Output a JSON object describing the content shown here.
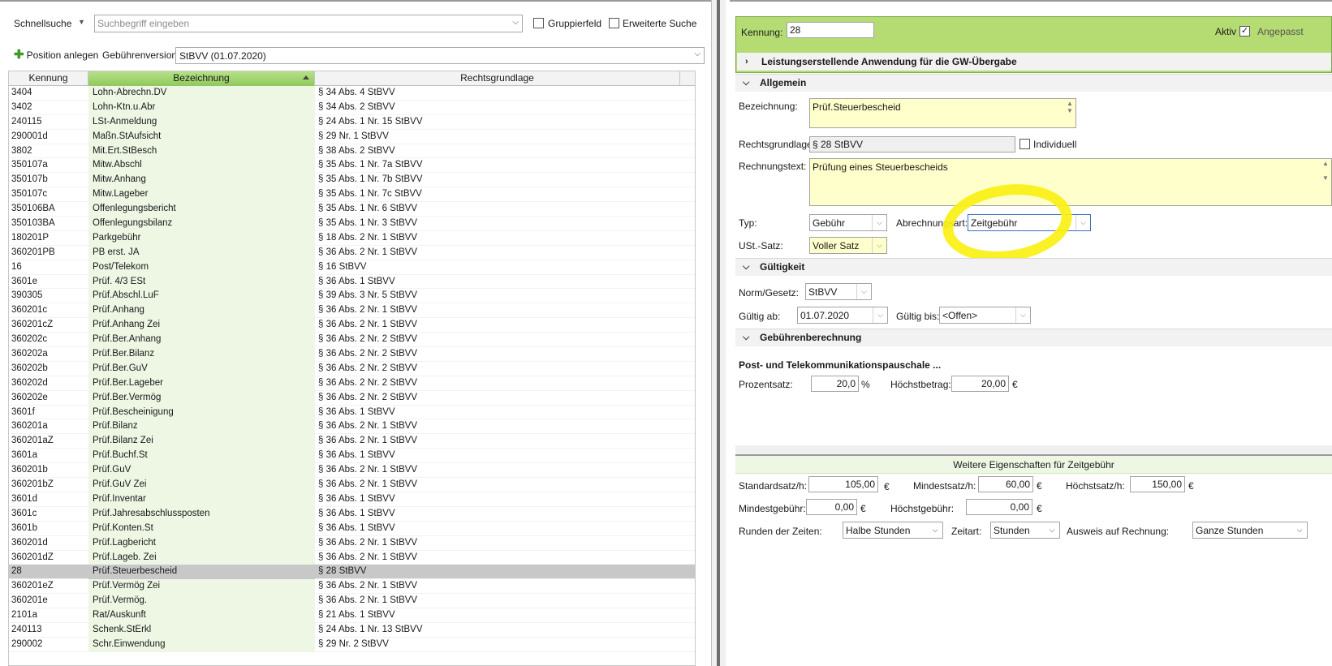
{
  "search": {
    "quick_label": "Schnellsuche",
    "placeholder": "Suchbegriff eingeben",
    "group_field_label": "Gruppierfeld",
    "extended_search_label": "Erweiterte Suche"
  },
  "toolbar": {
    "add_position_label": "Position anlegen",
    "fee_version_label": "Gebührenversion:",
    "fee_version_value": "StBVV (01.07.2020)"
  },
  "grid": {
    "columns": [
      "Kennung",
      "Bezeichnung",
      "Rechtsgrundlage"
    ],
    "selected_kennung": "28",
    "rows": [
      [
        "3404",
        "Lohn-Abrechn.DV",
        "§ 34 Abs. 4 StBVV"
      ],
      [
        "3402",
        "Lohn-Ktn.u.Abr",
        "§ 34 Abs. 2 StBVV"
      ],
      [
        "240115",
        "LSt-Anmeldung",
        "§ 24 Abs. 1 Nr. 15 StBVV"
      ],
      [
        "290001d",
        "Maßn.StAufsicht",
        "§ 29 Nr. 1 StBVV"
      ],
      [
        "3802",
        "Mit.Ert.StBesch",
        "§ 38 Abs. 2 StBVV"
      ],
      [
        "350107a",
        "Mitw.Abschl",
        "§ 35 Abs. 1 Nr. 7a StBVV"
      ],
      [
        "350107b",
        "Mitw.Anhang",
        "§ 35 Abs. 1 Nr. 7b StBVV"
      ],
      [
        "350107c",
        "Mitw.Lageber",
        "§ 35 Abs. 1 Nr. 7c StBVV"
      ],
      [
        "350106BA",
        "Offenlegungsbericht",
        "§ 35 Abs. 1 Nr. 6 StBVV"
      ],
      [
        "350103BA",
        "Offenlegungsbilanz",
        "§ 35 Abs. 1 Nr. 3 StBVV"
      ],
      [
        "180201P",
        "Parkgebühr",
        "§ 18 Abs. 2 Nr. 1 StBVV"
      ],
      [
        "360201PB",
        "PB erst. JA",
        "§ 36 Abs. 2 Nr. 1 StBVV"
      ],
      [
        "16",
        "Post/Telekom",
        "§ 16 StBVV"
      ],
      [
        "3601e",
        "Prüf. 4/3 ESt",
        "§ 36 Abs. 1 StBVV"
      ],
      [
        "390305",
        "Prüf.Abschl.LuF",
        "§ 39 Abs. 3 Nr. 5 StBVV"
      ],
      [
        "360201c",
        "Prüf.Anhang",
        "§ 36 Abs. 2 Nr. 1 StBVV"
      ],
      [
        "360201cZ",
        "Prüf.Anhang Zei",
        "§ 36 Abs. 2 Nr. 1 StBVV"
      ],
      [
        "360202c",
        "Prüf.Ber.Anhang",
        "§ 36 Abs. 2 Nr. 2 StBVV"
      ],
      [
        "360202a",
        "Prüf.Ber.Bilanz",
        "§ 36 Abs. 2 Nr. 2 StBVV"
      ],
      [
        "360202b",
        "Prüf.Ber.GuV",
        "§ 36 Abs. 2 Nr. 2 StBVV"
      ],
      [
        "360202d",
        "Prüf.Ber.Lageber",
        "§ 36 Abs. 2 Nr. 2 StBVV"
      ],
      [
        "360202e",
        "Prüf.Ber.Vermög",
        "§ 36 Abs. 2 Nr. 2 StBVV"
      ],
      [
        "3601f",
        "Prüf.Bescheinigung",
        "§ 36 Abs. 1 StBVV"
      ],
      [
        "360201a",
        "Prüf.Bilanz",
        "§ 36 Abs. 2 Nr. 1 StBVV"
      ],
      [
        "360201aZ",
        "Prüf.Bilanz Zei",
        "§ 36 Abs. 2 Nr. 1 StBVV"
      ],
      [
        "3601a",
        "Prüf.Buchf.St",
        "§ 36 Abs. 1 StBVV"
      ],
      [
        "360201b",
        "Prüf.GuV",
        "§ 36 Abs. 2 Nr. 1 StBVV"
      ],
      [
        "360201bZ",
        "Prüf.GuV Zei",
        "§ 36 Abs. 2 Nr. 1 StBVV"
      ],
      [
        "3601d",
        "Prüf.Inventar",
        "§ 36 Abs. 1 StBVV"
      ],
      [
        "3601c",
        "Prüf.Jahresabschlussposten",
        "§ 36 Abs. 1 StBVV"
      ],
      [
        "3601b",
        "Prüf.Konten.St",
        "§ 36 Abs. 1 StBVV"
      ],
      [
        "360201d",
        "Prüf.Lagbericht",
        "§ 36 Abs. 2 Nr. 1 StBVV"
      ],
      [
        "360201dZ",
        "Prüf.Lageb. Zei",
        "§ 36 Abs. 2 Nr. 1 StBVV"
      ],
      [
        "28",
        "Prüf.Steuerbescheid",
        "§ 28 StBVV"
      ],
      [
        "360201eZ",
        "Prüf.Vermög Zei",
        "§ 36 Abs. 2 Nr. 1 StBVV"
      ],
      [
        "360201e",
        "Prüf.Vermög.",
        "§ 36 Abs. 2 Nr. 1 StBVV"
      ],
      [
        "2101a",
        "Rat/Auskunft",
        "§ 21 Abs. 1 StBVV"
      ],
      [
        "240113",
        "Schenk.StErkl",
        "§ 24 Abs. 1 Nr. 13 StBVV"
      ],
      [
        "290002",
        "Schr.Einwendung",
        "§ 29 Nr. 2 StBVV"
      ]
    ]
  },
  "detail": {
    "kennung_label": "Kennung:",
    "kennung_value": "28",
    "aktiv_label": "Aktiv",
    "angepasst_label": "Angepasst",
    "leistung_title": "Leistungserstellende Anwendung für die GW-Übergabe",
    "allgemein_title": "Allgemein",
    "bezeichnung_label": "Bezeichnung:",
    "bezeichnung_value": "Prüf.Steuerbescheid",
    "rechtsgrundlage_label": "Rechtsgrundlage:",
    "rechtsgrundlage_value": "§ 28 StBVV",
    "individuell_label": "Individuell",
    "rechnungstext_label": "Rechnungstext:",
    "rechnungstext_value": "Prüfung eines Steuerbescheids",
    "typ_label": "Typ:",
    "typ_value": "Gebühr",
    "abrechnungsart_label": "Abrechnungsart:",
    "abrechnungsart_value": "Zeitgebühr",
    "ust_label": "USt.-Satz:",
    "ust_value": "Voller Satz",
    "gueltigkeit_title": "Gültigkeit",
    "norm_label": "Norm/Gesetz:",
    "norm_value": "StBVV",
    "gueltig_ab_label": "Gültig ab:",
    "gueltig_ab_value": "01.07.2020",
    "gueltig_bis_label": "Gültig bis:",
    "gueltig_bis_value": "<Offen>",
    "gebuehren_title": "Gebührenberechnung",
    "pauschale_title": "Post- und Telekommunikationspauschale ...",
    "prozentsatz_label": "Prozentsatz:",
    "prozentsatz_value": "20,0",
    "prozent_unit": "%",
    "hoechstbetrag_label": "Höchstbetrag:",
    "hoechstbetrag_value": "20,00",
    "euro": "€"
  },
  "zeitgebuehr": {
    "title": "Weitere Eigenschaften für Zeitgebühr",
    "standardsatz_label": "Standardsatz/h:",
    "standardsatz_value": "105,00",
    "mindestsatz_label": "Mindestsatz/h:",
    "mindestsatz_value": "60,00",
    "hoechstsatz_label": "Höchstsatz/h:",
    "hoechstsatz_value": "150,00",
    "mindestgebuehr_label": "Mindestgebühr:",
    "mindestgebuehr_value": "0,00",
    "hoechstgebuehr_label": "Höchstgebühr:",
    "hoechstgebuehr_value": "0,00",
    "runden_label": "Runden der Zeiten:",
    "runden_value": "Halbe Stunden",
    "zeitart_label": "Zeitart:",
    "zeitart_value": "Stunden",
    "ausweis_label": "Ausweis auf Rechnung:",
    "ausweis_value": "Ganze Stunden"
  },
  "colors": {
    "header_green": "#b5dc73",
    "column_green": "#8fc95a",
    "field_yellow": "#ffffcc",
    "highlight_yellow": "#faf014"
  }
}
